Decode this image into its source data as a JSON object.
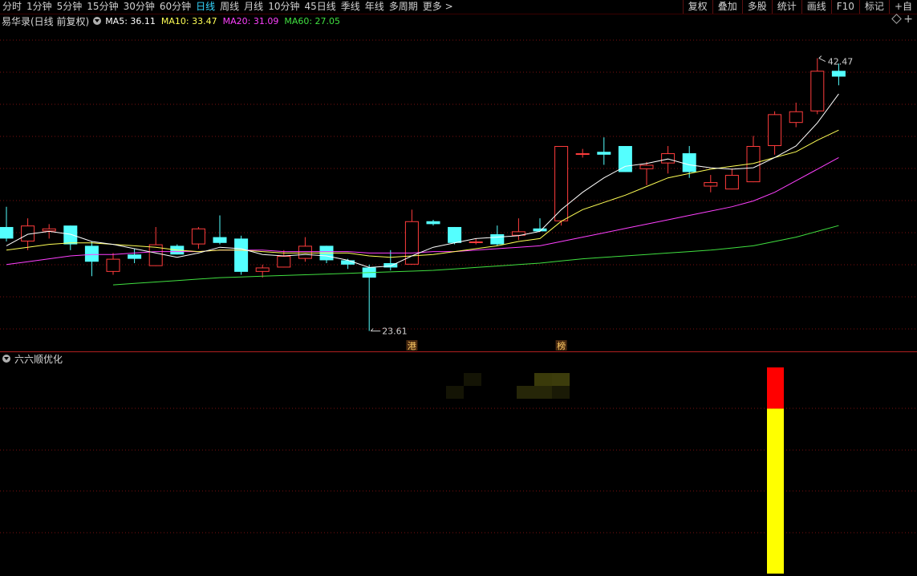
{
  "toolbar": {
    "periods": [
      "分时",
      "1分钟",
      "5分钟",
      "15分钟",
      "30分钟",
      "60分钟",
      "日线",
      "周线",
      "月线",
      "10分钟",
      "45日线",
      "季线",
      "年线",
      "多周期",
      "更多 >"
    ],
    "active_period": "日线",
    "tools": [
      "复权",
      "叠加",
      "多股",
      "统计",
      "画线",
      "F10",
      "标记",
      "+自"
    ]
  },
  "info": {
    "stock_title": "易华录(日线 前复权)",
    "ma5": "MA5: 36.11",
    "ma10": "MA10: 33.47",
    "ma20": "MA20: 31.09",
    "ma60": "MA60: 27.05"
  },
  "colors": {
    "up": "#ff3c3c",
    "down": "#54ffff",
    "ma5": "#ffffff",
    "ma10": "#ffff55",
    "ma20": "#ff40ff",
    "ma60": "#40e040",
    "grid": "#7a1010",
    "indicator_top": "#ff0000",
    "indicator_body": "#ffff00"
  },
  "chart_data": {
    "type": "candlestick",
    "ylim": [
      22.2,
      44.5
    ],
    "labels": {
      "high_label": "42.47",
      "low_label": "23.61",
      "marker_1": "港",
      "marker_2": "榜"
    },
    "candles": [
      {
        "o": 30.8,
        "h": 32.2,
        "l": 29.8,
        "c": 30.0
      },
      {
        "o": 29.8,
        "h": 31.4,
        "l": 29.2,
        "c": 30.9
      },
      {
        "o": 30.5,
        "h": 31.0,
        "l": 30.0,
        "c": 30.7
      },
      {
        "o": 30.9,
        "h": 30.9,
        "l": 29.2,
        "c": 29.6
      },
      {
        "o": 29.5,
        "h": 29.8,
        "l": 27.4,
        "c": 28.4
      },
      {
        "o": 27.7,
        "h": 29.0,
        "l": 27.5,
        "c": 28.6
      },
      {
        "o": 28.9,
        "h": 29.3,
        "l": 28.3,
        "c": 28.6
      },
      {
        "o": 28.1,
        "h": 30.8,
        "l": 28.1,
        "c": 29.6
      },
      {
        "o": 29.5,
        "h": 29.6,
        "l": 28.9,
        "c": 28.9
      },
      {
        "o": 29.6,
        "h": 30.8,
        "l": 29.3,
        "c": 30.7
      },
      {
        "o": 30.1,
        "h": 31.6,
        "l": 29.6,
        "c": 29.7
      },
      {
        "o": 30.0,
        "h": 30.2,
        "l": 27.5,
        "c": 27.7
      },
      {
        "o": 27.7,
        "h": 28.2,
        "l": 27.3,
        "c": 28.0
      },
      {
        "o": 28.0,
        "h": 29.2,
        "l": 28.0,
        "c": 28.8
      },
      {
        "o": 28.6,
        "h": 30.1,
        "l": 28.4,
        "c": 29.5
      },
      {
        "o": 29.5,
        "h": 29.5,
        "l": 28.3,
        "c": 28.5
      },
      {
        "o": 28.5,
        "h": 28.6,
        "l": 27.9,
        "c": 28.2
      },
      {
        "o": 28.0,
        "h": 28.2,
        "l": 23.61,
        "c": 27.3
      },
      {
        "o": 28.3,
        "h": 29.2,
        "l": 27.8,
        "c": 28.0
      },
      {
        "o": 28.2,
        "h": 32.0,
        "l": 28.2,
        "c": 31.2
      },
      {
        "o": 31.2,
        "h": 31.3,
        "l": 30.9,
        "c": 31.0
      },
      {
        "o": 30.8,
        "h": 30.8,
        "l": 29.6,
        "c": 29.7
      },
      {
        "o": 29.8,
        "h": 30.0,
        "l": 29.6,
        "c": 29.8
      },
      {
        "o": 30.3,
        "h": 30.9,
        "l": 29.5,
        "c": 29.6
      },
      {
        "o": 30.2,
        "h": 31.4,
        "l": 29.9,
        "c": 30.5
      },
      {
        "o": 30.7,
        "h": 31.4,
        "l": 30.5,
        "c": 30.5
      },
      {
        "o": 31.2,
        "h": 36.4,
        "l": 30.9,
        "c": 36.4
      },
      {
        "o": 35.9,
        "h": 36.2,
        "l": 35.6,
        "c": 35.9
      },
      {
        "o": 36.0,
        "h": 37.0,
        "l": 35.1,
        "c": 35.8
      },
      {
        "o": 36.4,
        "h": 36.4,
        "l": 34.6,
        "c": 34.6
      },
      {
        "o": 34.8,
        "h": 35.3,
        "l": 33.7,
        "c": 35.1
      },
      {
        "o": 35.2,
        "h": 36.4,
        "l": 34.5,
        "c": 35.9
      },
      {
        "o": 35.9,
        "h": 36.4,
        "l": 34.2,
        "c": 34.6
      },
      {
        "o": 33.6,
        "h": 34.4,
        "l": 33.2,
        "c": 33.9
      },
      {
        "o": 33.4,
        "h": 34.8,
        "l": 33.4,
        "c": 34.4
      },
      {
        "o": 33.9,
        "h": 37.1,
        "l": 33.9,
        "c": 36.4
      },
      {
        "o": 36.4,
        "h": 38.8,
        "l": 35.8,
        "c": 38.6
      },
      {
        "o": 38.0,
        "h": 39.4,
        "l": 37.7,
        "c": 38.8
      },
      {
        "o": 38.8,
        "h": 42.47,
        "l": 38.6,
        "c": 41.6
      },
      {
        "o": 41.6,
        "h": 42.1,
        "l": 40.6,
        "c": 41.2
      }
    ],
    "ma5": [
      29.5,
      30.3,
      30.5,
      30.3,
      29.8,
      29.6,
      29.3,
      29.0,
      28.7,
      29.0,
      29.4,
      29.3,
      28.9,
      28.8,
      28.9,
      28.8,
      28.5,
      28.0,
      28.1,
      28.8,
      29.4,
      29.7,
      30.0,
      30.1,
      30.2,
      30.5,
      32.0,
      33.2,
      34.2,
      35.0,
      35.2,
      35.5,
      35.1,
      34.9,
      34.8,
      34.9,
      35.6,
      36.4,
      38.0,
      40.0
    ],
    "ma10": [
      29.2,
      29.4,
      29.6,
      29.7,
      29.7,
      29.6,
      29.5,
      29.4,
      29.2,
      29.1,
      29.2,
      29.2,
      29.1,
      29.0,
      29.0,
      29.0,
      29.0,
      28.8,
      28.7,
      28.8,
      28.9,
      29.1,
      29.3,
      29.5,
      29.8,
      30.0,
      31.2,
      32.0,
      32.5,
      33.0,
      33.6,
      34.2,
      34.5,
      34.8,
      35.0,
      35.2,
      35.6,
      36.0,
      36.8,
      37.5
    ],
    "ma20": [
      28.2,
      28.4,
      28.6,
      28.8,
      28.9,
      28.9,
      29.0,
      29.1,
      29.1,
      29.1,
      29.2,
      29.2,
      29.2,
      29.1,
      29.1,
      29.1,
      29.1,
      29.0,
      29.0,
      29.0,
      29.1,
      29.1,
      29.2,
      29.3,
      29.4,
      29.5,
      29.8,
      30.1,
      30.4,
      30.7,
      31.0,
      31.3,
      31.6,
      31.9,
      32.2,
      32.6,
      33.2,
      34.0,
      34.8,
      35.6
    ],
    "ma60": [
      null,
      null,
      null,
      null,
      null,
      26.8,
      26.9,
      27.0,
      27.1,
      27.2,
      27.3,
      27.35,
      27.4,
      27.45,
      27.5,
      27.55,
      27.6,
      27.65,
      27.7,
      27.75,
      27.8,
      27.9,
      28.0,
      28.1,
      28.2,
      28.3,
      28.45,
      28.6,
      28.7,
      28.8,
      28.9,
      29.0,
      29.1,
      29.2,
      29.35,
      29.5,
      29.8,
      30.1,
      30.5,
      30.9
    ]
  },
  "indicator": {
    "title": "六六顺优化",
    "bar_top_fraction": 0.2,
    "bar_level": 1.0
  }
}
